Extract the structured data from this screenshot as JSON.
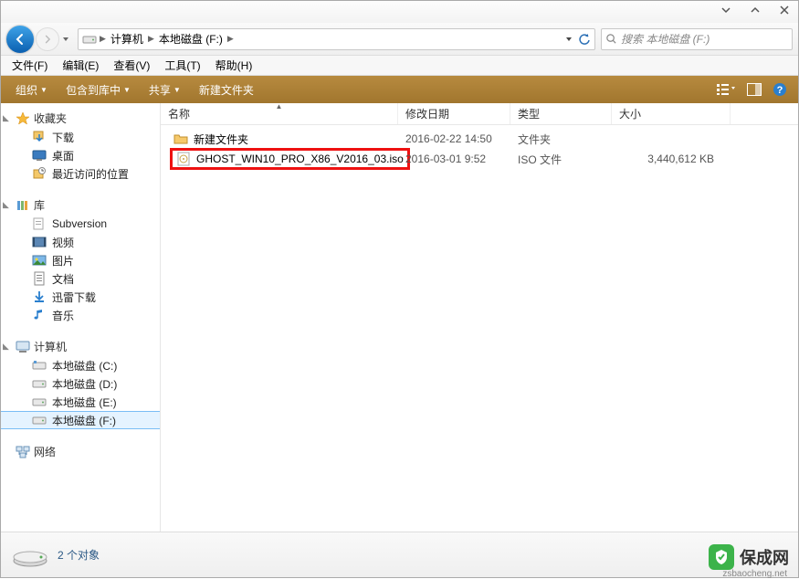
{
  "window_controls": {
    "min": "_",
    "max": "□",
    "close": "×"
  },
  "breadcrumb": {
    "seg0": "计算机",
    "seg1": "本地磁盘 (F:)"
  },
  "search": {
    "placeholder": "搜索 本地磁盘 (F:)"
  },
  "menus": {
    "file": "文件(F)",
    "edit": "编辑(E)",
    "view": "查看(V)",
    "tools": "工具(T)",
    "help": "帮助(H)"
  },
  "cmdbar": {
    "org": "组织",
    "include": "包含到库中",
    "share": "共享",
    "newfolder": "新建文件夹"
  },
  "columns": {
    "name": "名称",
    "date": "修改日期",
    "type": "类型",
    "size": "大小"
  },
  "sidebar": {
    "fav": "收藏夹",
    "fav_items": {
      "dl": "下载",
      "desk": "桌面",
      "recent": "最近访问的位置"
    },
    "lib": "库",
    "lib_items": {
      "svn": "Subversion",
      "vid": "视频",
      "pic": "图片",
      "doc": "文档",
      "xl": "迅雷下载",
      "music": "音乐"
    },
    "comp": "计算机",
    "comp_items": {
      "c": "本地磁盘 (C:)",
      "d": "本地磁盘 (D:)",
      "e": "本地磁盘 (E:)",
      "f": "本地磁盘 (F:)"
    },
    "net": "网络"
  },
  "files": [
    {
      "name": "新建文件夹",
      "date": "2016-02-22 14:50",
      "type": "文件夹",
      "size": ""
    },
    {
      "name": "GHOST_WIN10_PRO_X86_V2016_03.iso",
      "date": "2016-03-01 9:52",
      "type": "ISO 文件",
      "size": "3,440,612 KB"
    }
  ],
  "status": {
    "count": "2 个对象"
  },
  "watermark": {
    "text": "保成网",
    "sub": "zsbaocheng.net"
  }
}
